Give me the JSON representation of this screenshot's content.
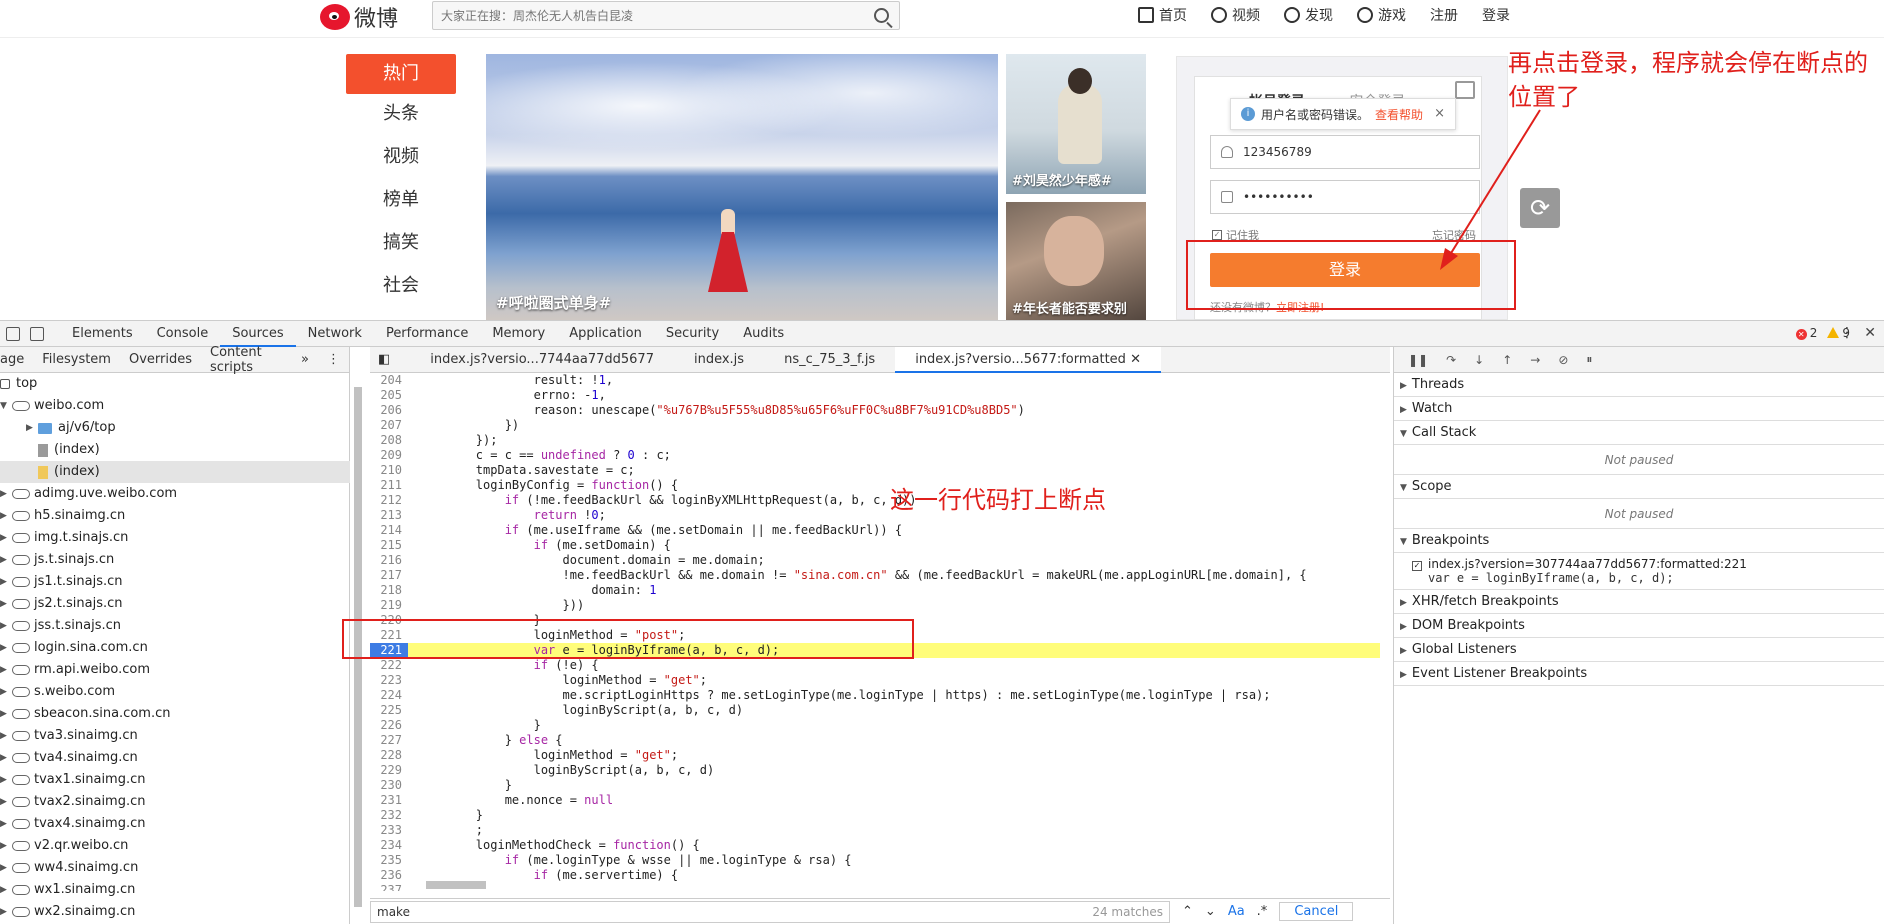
{
  "header": {
    "logo_text": "微博",
    "search_placeholder": "大家正在搜：周杰伦无人机告白昆凌",
    "nav": [
      {
        "label": "首页",
        "icon": "home-icon"
      },
      {
        "label": "视频",
        "icon": "video-icon"
      },
      {
        "label": "发现",
        "icon": "discover-icon"
      },
      {
        "label": "游戏",
        "icon": "game-icon"
      }
    ],
    "register": "注册",
    "login": "登录"
  },
  "left_nav": [
    "热门",
    "头条",
    "视频",
    "榜单",
    "搞笑",
    "社会"
  ],
  "hero": {
    "tag": "#呼啦圈式单身#"
  },
  "side_cards": [
    "#刘昊然少年感#",
    "#年长者能否要求别"
  ],
  "login": {
    "tab": "帐号登录",
    "tab2": "安全登录",
    "tip_text": "用户名或密码错误。",
    "tip_help": "查看帮助",
    "tip_close": "×",
    "username": "123456789",
    "password": "••••••••••",
    "remember": "记住我",
    "forgot": "忘记密码",
    "button": "登录",
    "register_prompt": "还没有微博？",
    "register_link": "立即注册!"
  },
  "annotations": {
    "top_right": "再点击登录，程序就会停在断点的位置了",
    "middle": "这一行代码打上断点"
  },
  "devtools": {
    "tabs": [
      "Elements",
      "Console",
      "Sources",
      "Network",
      "Performance",
      "Memory",
      "Application",
      "Security",
      "Audits"
    ],
    "active_tab": "Sources",
    "errors": "2",
    "warnings": "9",
    "nav_tabs": [
      "age",
      "Filesystem",
      "Overrides",
      "Content scripts",
      "»"
    ],
    "tree": [
      {
        "label": "top",
        "kind": "frame",
        "indent": 0
      },
      {
        "label": "weibo.com",
        "kind": "cloud",
        "indent": 0,
        "open": true
      },
      {
        "label": "aj/v6/top",
        "kind": "folder",
        "indent": 1
      },
      {
        "label": "(index)",
        "kind": "file",
        "indent": 1
      },
      {
        "label": "(index)",
        "kind": "file-y",
        "indent": 1,
        "selected": true
      },
      {
        "label": "adimg.uve.weibo.com",
        "kind": "cloud",
        "indent": 0
      },
      {
        "label": "h5.sinaimg.cn",
        "kind": "cloud",
        "indent": 0
      },
      {
        "label": "img.t.sinajs.cn",
        "kind": "cloud",
        "indent": 0
      },
      {
        "label": "js.t.sinajs.cn",
        "kind": "cloud",
        "indent": 0
      },
      {
        "label": "js1.t.sinajs.cn",
        "kind": "cloud",
        "indent": 0
      },
      {
        "label": "js2.t.sinajs.cn",
        "kind": "cloud",
        "indent": 0
      },
      {
        "label": "jss.t.sinajs.cn",
        "kind": "cloud",
        "indent": 0
      },
      {
        "label": "login.sina.com.cn",
        "kind": "cloud",
        "indent": 0
      },
      {
        "label": "rm.api.weibo.com",
        "kind": "cloud",
        "indent": 0
      },
      {
        "label": "s.weibo.com",
        "kind": "cloud",
        "indent": 0
      },
      {
        "label": "sbeacon.sina.com.cn",
        "kind": "cloud",
        "indent": 0
      },
      {
        "label": "tva3.sinaimg.cn",
        "kind": "cloud",
        "indent": 0
      },
      {
        "label": "tva4.sinaimg.cn",
        "kind": "cloud",
        "indent": 0
      },
      {
        "label": "tvax1.sinaimg.cn",
        "kind": "cloud",
        "indent": 0
      },
      {
        "label": "tvax2.sinaimg.cn",
        "kind": "cloud",
        "indent": 0
      },
      {
        "label": "tvax4.sinaimg.cn",
        "kind": "cloud",
        "indent": 0
      },
      {
        "label": "v2.qr.weibo.cn",
        "kind": "cloud",
        "indent": 0
      },
      {
        "label": "ww4.sinaimg.cn",
        "kind": "cloud",
        "indent": 0
      },
      {
        "label": "wx1.sinaimg.cn",
        "kind": "cloud",
        "indent": 0
      },
      {
        "label": "wx2.sinaimg.cn",
        "kind": "cloud",
        "indent": 0
      }
    ],
    "editor_tabs": [
      "index.js?versio...7744aa77dd5677",
      "index.js",
      "ns_c_75_3_f.js",
      "index.js?versio...5677:formatted"
    ],
    "active_editor_tab": 3,
    "breakpoint_line": "221",
    "code": [
      [
        "204",
        "                result: !1,"
      ],
      [
        "205",
        "                errno: -1,"
      ],
      [
        "206",
        "                reason: unescape(\"%u767B%u5F55%u8D85%u65F6%uFF0C%u8BF7%u91CD%u8BD5\")"
      ],
      [
        "207",
        "            })"
      ],
      [
        "208",
        "        });"
      ],
      [
        "209",
        "        c = c == undefined ? 0 : c;"
      ],
      [
        "210",
        "        tmpData.savestate = c;"
      ],
      [
        "211",
        "        loginByConfig = function() {"
      ],
      [
        "212",
        "            if (!me.feedBackUrl && loginByXMLHttpRequest(a, b, c, d))"
      ],
      [
        "213",
        "                return !0;"
      ],
      [
        "214",
        "            if (me.useIframe && (me.setDomain || me.feedBackUrl)) {"
      ],
      [
        "215",
        "                if (me.setDomain) {"
      ],
      [
        "216",
        "                    document.domain = me.domain;"
      ],
      [
        "217",
        "                    !me.feedBackUrl && me.domain != \"sina.com.cn\" && (me.feedBackUrl = makeURL(me.appLoginURL[me.domain], {"
      ],
      [
        "218",
        "                        domain: 1"
      ],
      [
        "219",
        "                    }))"
      ],
      [
        "220",
        "                }"
      ],
      [
        "221",
        "                loginMethod = \"post\";"
      ],
      [
        "221",
        "                var e = loginByIframe(a, b, c, d);"
      ],
      [
        "222",
        "                if (!e) {"
      ],
      [
        "223",
        "                    loginMethod = \"get\";"
      ],
      [
        "224",
        "                    me.scriptLoginHttps ? me.setLoginType(me.loginType | https) : me.setLoginType(me.loginType | rsa);"
      ],
      [
        "225",
        "                    loginByScript(a, b, c, d)"
      ],
      [
        "226",
        "                }"
      ],
      [
        "227",
        "            } else {"
      ],
      [
        "228",
        "                loginMethod = \"get\";"
      ],
      [
        "229",
        "                loginByScript(a, b, c, d)"
      ],
      [
        "230",
        "            }"
      ],
      [
        "231",
        "            me.nonce = null"
      ],
      [
        "232",
        "        }"
      ],
      [
        "233",
        "        ;"
      ],
      [
        "234",
        "        loginMethodCheck = function() {"
      ],
      [
        "235",
        "            if (me.loginType & wsse || me.loginType & rsa) {"
      ],
      [
        "236",
        "                if (me.servertime) {"
      ],
      [
        "237",
        "                    ..."
      ]
    ],
    "find": {
      "query": "make",
      "matches": "24 matches",
      "aa": "Aa",
      "regex": ".*",
      "cancel": "Cancel"
    },
    "debugger": {
      "sections": [
        "Threads",
        "Watch",
        "Call Stack",
        "Scope",
        "Breakpoints",
        "XHR/fetch Breakpoints",
        "DOM Breakpoints",
        "Global Listeners",
        "Event Listener Breakpoints"
      ],
      "not_paused": "Not paused",
      "bp_file": "index.js?version=307744aa77dd5677:formatted:221",
      "bp_code": "var e = loginByIframe(a, b, c, d);"
    }
  }
}
